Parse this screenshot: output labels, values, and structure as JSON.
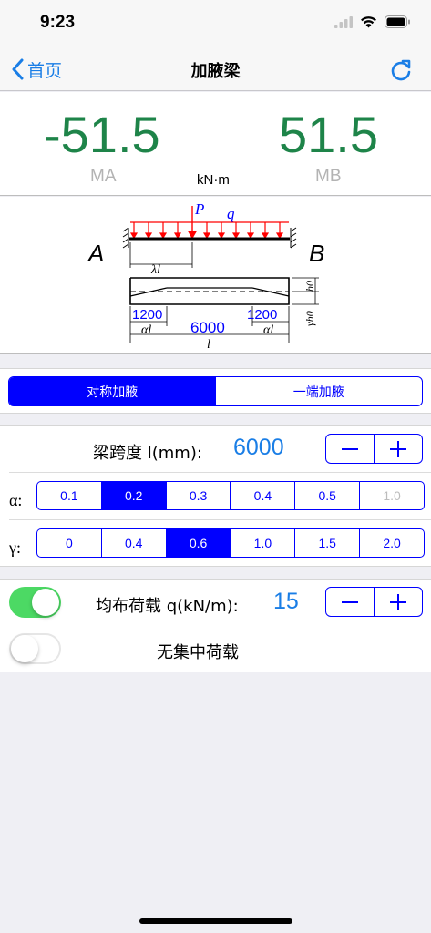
{
  "status": {
    "time": "9:23"
  },
  "nav": {
    "back_label": "首页",
    "title": "加腋梁"
  },
  "moments": {
    "ma_value": "-51.5",
    "mb_value": "51.5",
    "ma_label": "MA",
    "mb_label": "MB",
    "unit": "kN·m"
  },
  "diagram": {
    "label_a": "A",
    "label_b": "B",
    "label_p": "P",
    "label_q": "q",
    "label_lambda_l": "λl",
    "label_h0": "h0",
    "label_gamma_h0": "γh0",
    "left_haunch": "1200",
    "span": "6000",
    "right_haunch": "1200",
    "alpha_l_left": "αl",
    "alpha_l_right": "αl",
    "l": "l"
  },
  "haunch_mode": {
    "options": [
      "对称加腋",
      "一端加腋"
    ],
    "selected": 0
  },
  "span_row": {
    "label": "梁跨度 l(mm):",
    "value": "6000"
  },
  "alpha_row": {
    "symbol": "α:",
    "options": [
      "0.1",
      "0.2",
      "0.3",
      "0.4",
      "0.5",
      "1.0"
    ],
    "selected": 1,
    "disabled": 5
  },
  "gamma_row": {
    "symbol": "γ:",
    "options": [
      "0",
      "0.4",
      "0.6",
      "1.0",
      "1.5",
      "2.0"
    ],
    "selected": 2
  },
  "uniform_load": {
    "enabled": true,
    "label": "均布荷载 q(kN/m):",
    "value": "15"
  },
  "point_load": {
    "enabled": false,
    "label": "无集中荷载"
  },
  "colors": {
    "accent_blue": "#0000ff",
    "value_blue": "#1a7ee6",
    "moment_green": "#1e8449",
    "toggle_green": "#4cd964",
    "load_red": "#ff0000"
  }
}
